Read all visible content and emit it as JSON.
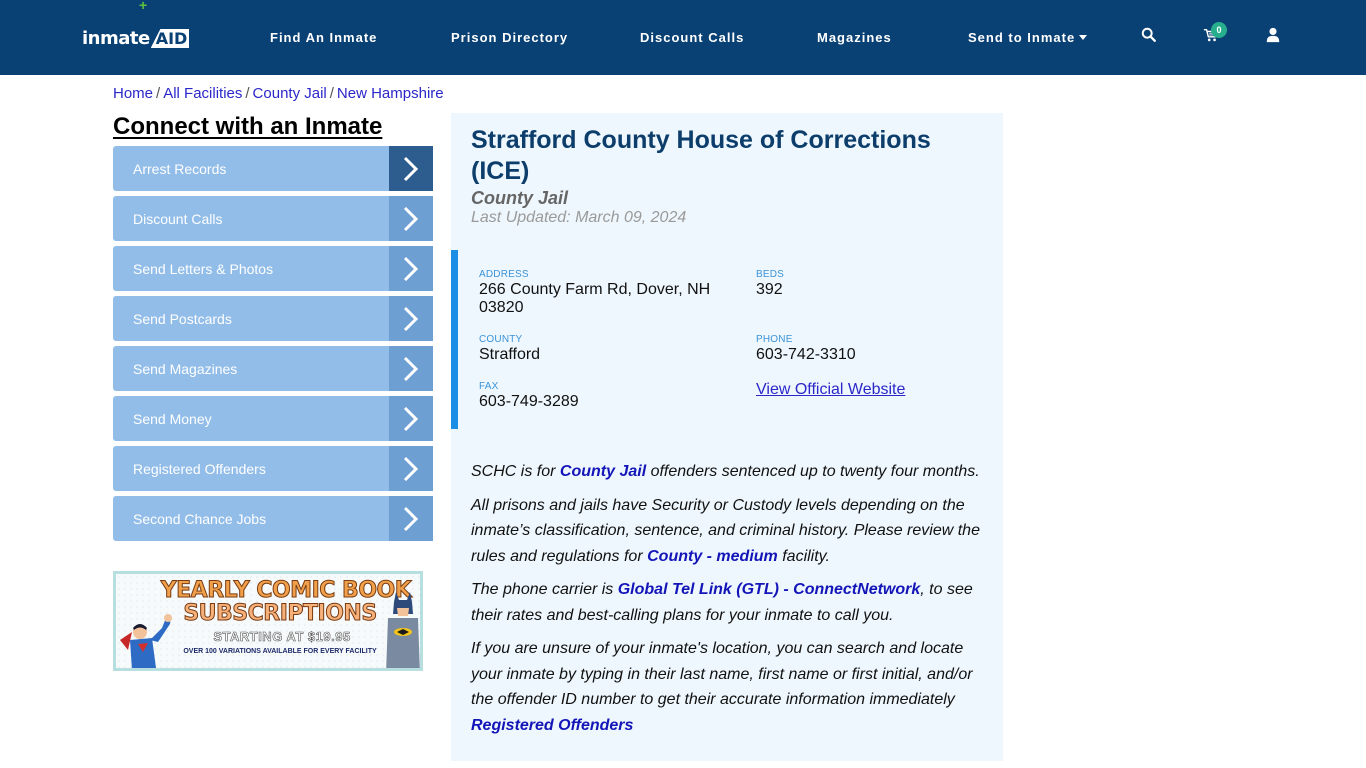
{
  "header": {
    "logo_text_main": "inmate",
    "logo_text_accent": "AID",
    "logo_plus": "+",
    "nav": [
      {
        "label": "Find An Inmate"
      },
      {
        "label": "Prison Directory"
      },
      {
        "label": "Discount Calls"
      },
      {
        "label": "Magazines"
      },
      {
        "label": "Send to Inmate"
      }
    ],
    "cart_count": "0",
    "icons": [
      "search-icon",
      "cart-icon",
      "user-icon"
    ],
    "background_color": "#0a4174"
  },
  "breadcrumb": [
    {
      "label": "Home"
    },
    {
      "label": "All Facilities"
    },
    {
      "label": "County Jail"
    },
    {
      "label": "New Hampshire"
    }
  ],
  "breadcrumb_separator": "/",
  "sidebar": {
    "title": "Connect with an Inmate",
    "items": [
      {
        "label": "Arrest Records",
        "active": true
      },
      {
        "label": "Discount Calls"
      },
      {
        "label": "Send Letters & Photos"
      },
      {
        "label": "Send Postcards"
      },
      {
        "label": "Send Magazines"
      },
      {
        "label": "Send Money"
      },
      {
        "label": "Registered Offenders"
      },
      {
        "label": "Second Chance Jobs"
      }
    ],
    "ad": {
      "line1": "YEARLY COMIC BOOK",
      "line2": "SUBSCRIPTIONS",
      "line3": "STARTING AT $19.95",
      "line4": "OVER 100 VARIATIONS AVAILABLE FOR EVERY FACILITY"
    }
  },
  "facility": {
    "name": "Strafford County House of Corrections (ICE)",
    "type": "County Jail",
    "last_updated": "Last Updated: March 09, 2024",
    "fields": {
      "address": {
        "label": "Address",
        "value": "266 County Farm Rd, Dover, NH 03820"
      },
      "beds": {
        "label": "Beds",
        "value": "392"
      },
      "county": {
        "label": "County",
        "value": "Strafford"
      },
      "phone": {
        "label": "Phone",
        "value": "603-742-3310"
      },
      "fax": {
        "label": "Fax",
        "value": "603-749-3289"
      }
    },
    "website_link": "View Official Website",
    "description": {
      "p1_before": "SCHC is for ",
      "p1_link": "County Jail",
      "p1_after": " offenders sentenced up to twenty four months.",
      "p2_before": "All prisons and jails have Security or Custody levels depending on the inmate’s classification, sentence, and criminal history. Please review the rules and regulations for ",
      "p2_link": "County - medium",
      "p2_after": " facility.",
      "p3_before": "The phone carrier is ",
      "p3_link": "Global Tel Link (GTL) - ConnectNetwork",
      "p3_after": ", to see their rates and best-calling plans for your inmate to call you.",
      "p4_text": "If you are unsure of your inmate's location, you can search and locate your inmate by typing in their last name, first name or first initial, and/or the offender ID number to get their accurate information immediately",
      "p4_link": "Registered Offenders"
    }
  },
  "colors": {
    "accent_blue": "#1c8ee6",
    "title_blue": "#0c3d6b",
    "link_blue": "#1315b8",
    "sidebar_item": "#92bde8",
    "sidebar_chevron": "#6d9fd2",
    "sidebar_chevron_active": "#2d5d8e",
    "badge_green": "#27ae8c"
  }
}
